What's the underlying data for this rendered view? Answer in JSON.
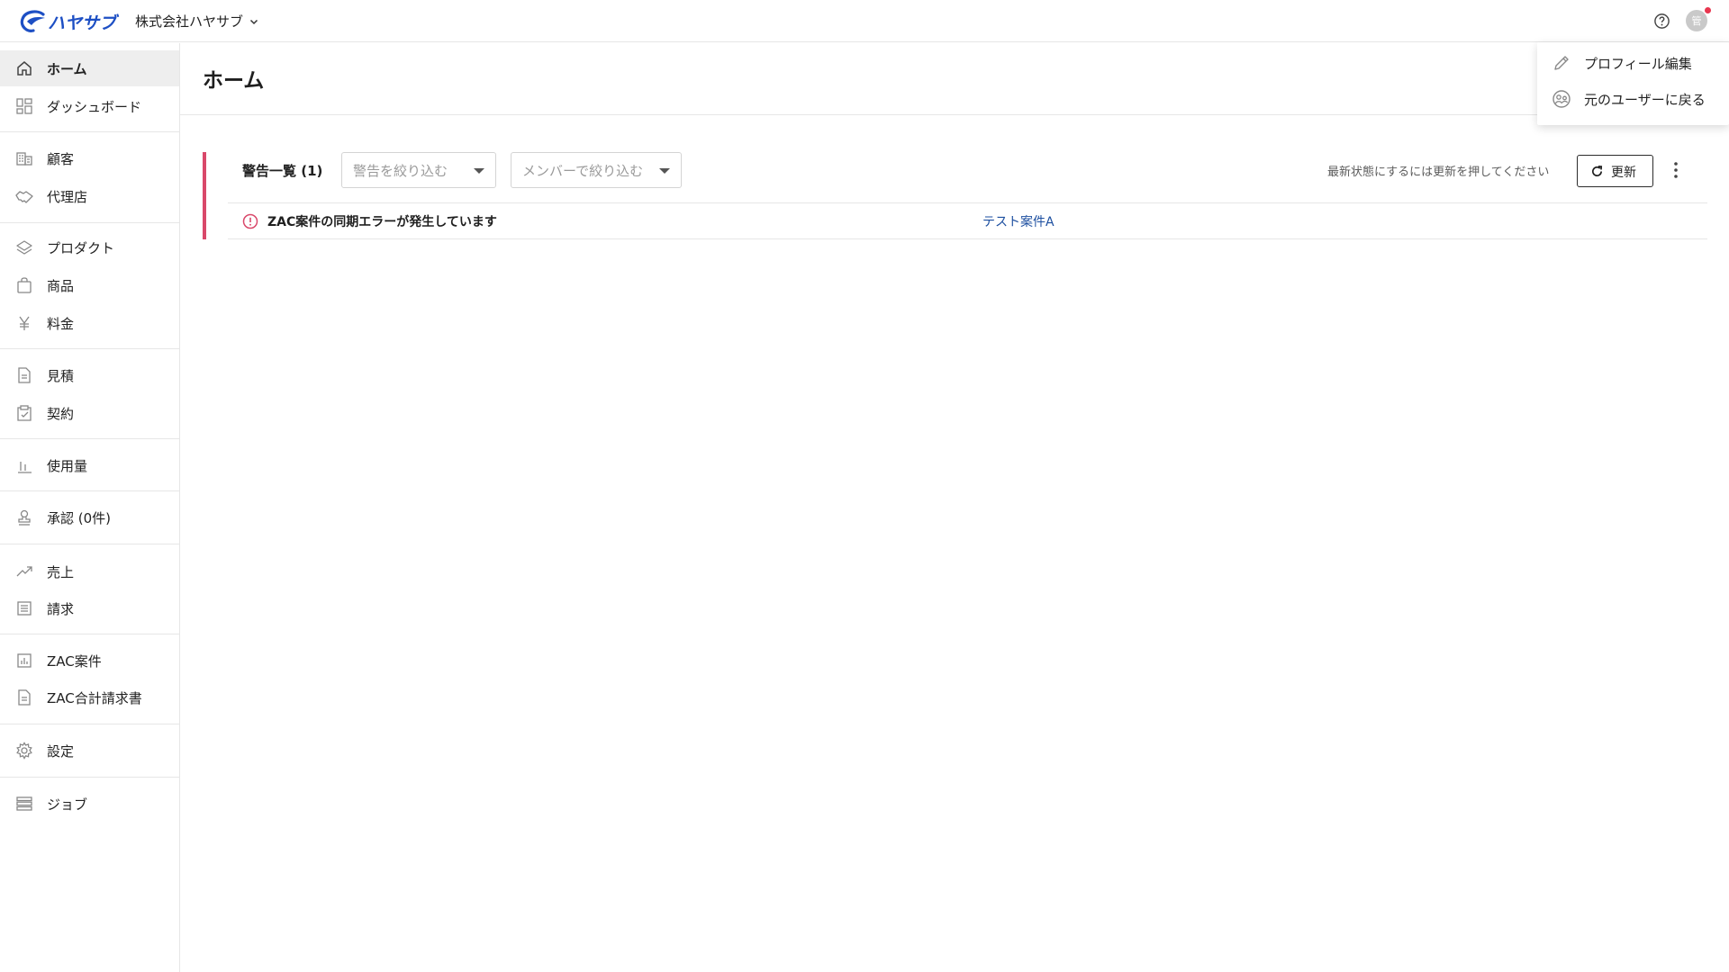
{
  "header": {
    "logo_text": "ハヤサブ",
    "company_name": "株式会社ハヤサブ",
    "avatar_initial": "管"
  },
  "sidebar": {
    "items": [
      {
        "label": "ホーム",
        "icon": "home-icon",
        "active": true
      },
      {
        "label": "ダッシュボード",
        "icon": "dashboard-icon"
      },
      {
        "label": "顧客",
        "icon": "building-icon"
      },
      {
        "label": "代理店",
        "icon": "handshake-icon"
      },
      {
        "label": "プロダクト",
        "icon": "layers-icon"
      },
      {
        "label": "商品",
        "icon": "shopping-bag-icon"
      },
      {
        "label": "料金",
        "icon": "yen-icon"
      },
      {
        "label": "見積",
        "icon": "document-icon"
      },
      {
        "label": "契約",
        "icon": "clipboard-check-icon"
      },
      {
        "label": "使用量",
        "icon": "bar-chart-icon"
      },
      {
        "label": "承認 (0件)",
        "icon": "stamp-icon"
      },
      {
        "label": "売上",
        "icon": "trending-up-icon"
      },
      {
        "label": "請求",
        "icon": "list-icon"
      },
      {
        "label": "ZAC案件",
        "icon": "chart-box-icon"
      },
      {
        "label": "ZAC合計請求書",
        "icon": "document-icon"
      },
      {
        "label": "設定",
        "icon": "gear-icon"
      },
      {
        "label": "ジョブ",
        "icon": "server-list-icon"
      }
    ]
  },
  "main": {
    "page_title": "ホーム",
    "alerts": {
      "title": "警告一覧 (1)",
      "filter_alert_placeholder": "警告を絞り込む",
      "filter_member_placeholder": "メンバーで絞り込む",
      "refresh_hint": "最新状態にするには更新を押してください",
      "refresh_label": "更新",
      "rows": [
        {
          "message": "ZAC案件の同期エラーが発生しています",
          "link": "テスト案件A"
        }
      ]
    }
  },
  "user_menu": {
    "items": [
      {
        "label": "プロフィール編集",
        "icon": "pencil-icon"
      },
      {
        "label": "元のユーザーに戻る",
        "icon": "user-switch-icon"
      }
    ]
  },
  "colors": {
    "brand": "#1d4fc4",
    "alert_accent": "#d9486a",
    "link": "#1d4fa0",
    "notification_dot": "#e8364f"
  }
}
